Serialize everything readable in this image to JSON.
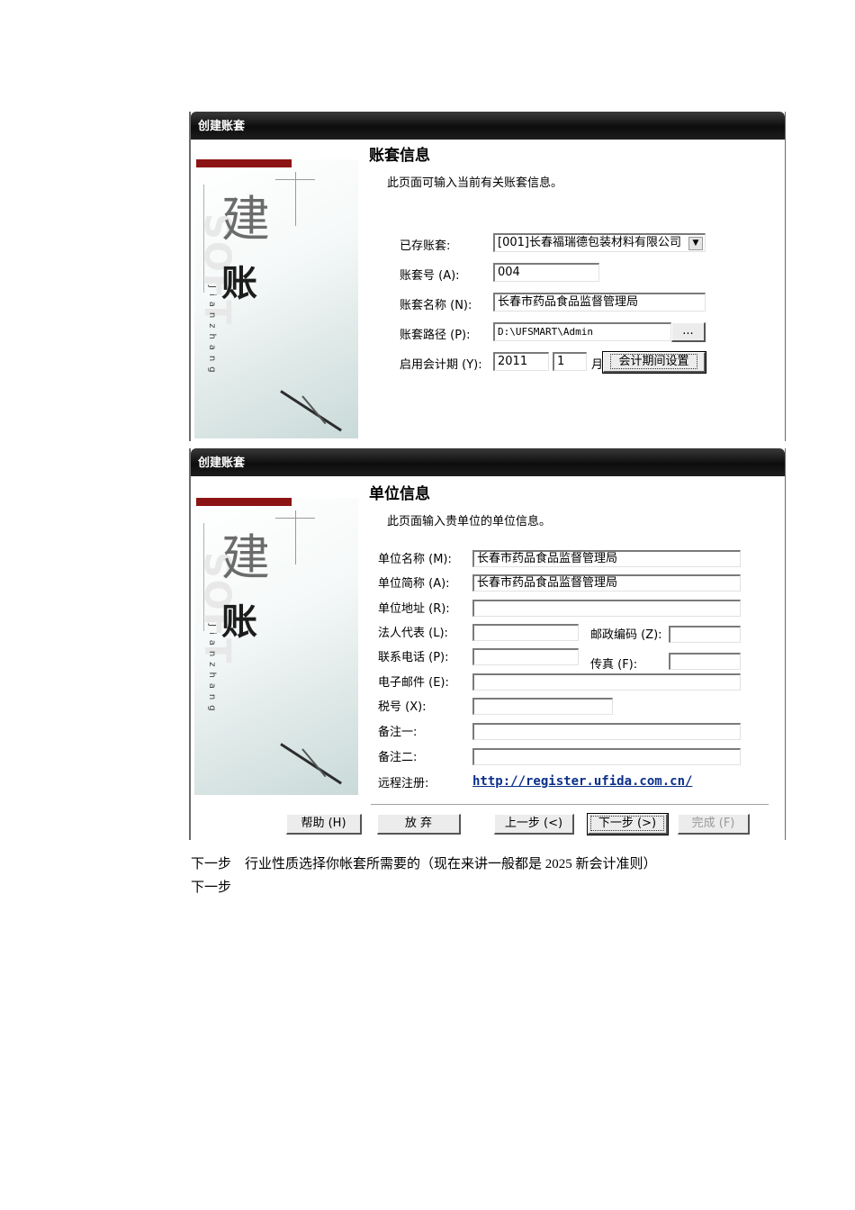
{
  "dialog1": {
    "title": "创建账套",
    "heading": "账套信息",
    "subtext": "此页面可输入当前有关账套信息。",
    "side": {
      "char1": "建",
      "char2": "账",
      "pinyin": "Jianzhang",
      "watermark": "SOFT"
    },
    "fields": {
      "existing_label": "已存账套:",
      "existing_value": "[001]长春福瑞德包装材料有限公司",
      "code_label": "账套号 (A):",
      "code_value": "004",
      "name_label": "账套名称 (N):",
      "name_value": "长春市药品食品监督管理局",
      "path_label": "账套路径 (P):",
      "path_value": "D:\\UFSMART\\Admin",
      "browse_label": "...",
      "period_label": "启用会计期 (Y):",
      "year_value": "2011",
      "month_value": "1",
      "month_unit": "月",
      "period_button": "会计期间设置"
    }
  },
  "dialog2": {
    "title": "创建账套",
    "heading": "单位信息",
    "subtext": "此页面输入贵单位的单位信息。",
    "side": {
      "char1": "建",
      "char2": "账",
      "pinyin": "Jianzhang",
      "watermark": "SOFT"
    },
    "fields": {
      "unit_name_label": "单位名称 (M):",
      "unit_name_value": "长春市药品食品监督管理局",
      "unit_short_label": "单位简称 (A):",
      "unit_short_value": "长春市药品食品监督管理局",
      "address_label": "单位地址 (R):",
      "legal_label": "法人代表 (L):",
      "postcode_label": "邮政编码 (Z):",
      "phone_label": "联系电话 (P):",
      "fax_label": "传真 (F):",
      "email_label": "电子邮件 (E):",
      "tax_label": "税号 (X):",
      "note1_label": "备注一:",
      "note2_label": "备注二:",
      "remote_label": "远程注册:",
      "remote_link": "http://register.ufida.com.cn/"
    },
    "buttons": {
      "help": "帮助 (H)",
      "abandon": "放 弃",
      "prev": "上一步 (<)",
      "next": "下一步 (>)",
      "finish": "完成 (F)"
    }
  },
  "text": {
    "line1": "下一步　行业性质选择你帐套所需要的（现在来讲一般都是 2025 新会计准则）",
    "line2": "下一步"
  }
}
